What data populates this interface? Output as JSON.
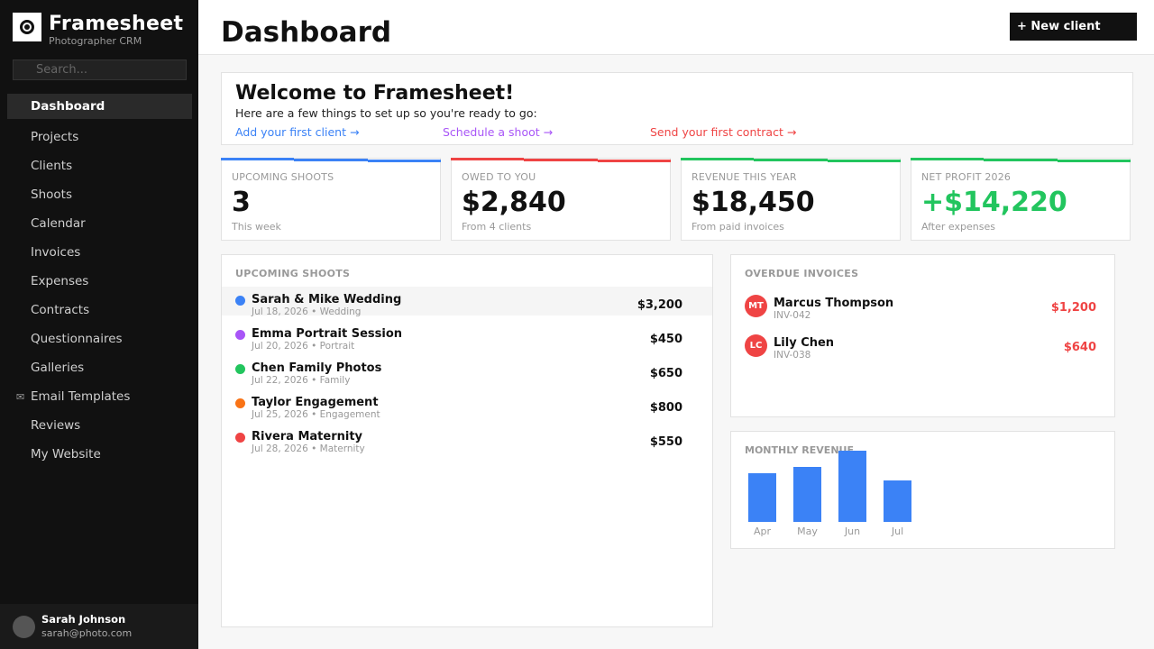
{
  "app": {
    "name": "Framesheet",
    "tagline": "Photographer CRM"
  },
  "search": {
    "placeholder": "Search..."
  },
  "nav": [
    {
      "icon": "dashboard-icon",
      "glyph": "",
      "label": "Dashboard",
      "active": true
    },
    {
      "icon": "projects-icon",
      "glyph": "",
      "label": "Projects"
    },
    {
      "icon": "clients-icon",
      "glyph": "",
      "label": "Clients"
    },
    {
      "icon": "shoots-icon",
      "glyph": "",
      "label": "Shoots"
    },
    {
      "icon": "calendar-icon",
      "glyph": "",
      "label": "Calendar"
    },
    {
      "icon": "invoices-icon",
      "glyph": "",
      "label": "Invoices"
    },
    {
      "icon": "expenses-icon",
      "glyph": "",
      "label": "Expenses"
    },
    {
      "icon": "contracts-icon",
      "glyph": "",
      "label": "Contracts"
    },
    {
      "icon": "questionnaires-icon",
      "glyph": "",
      "label": "Questionnaires"
    },
    {
      "icon": "galleries-icon",
      "glyph": "",
      "label": "Galleries"
    },
    {
      "icon": "email-icon",
      "glyph": "✉",
      "label": "Email Templates"
    },
    {
      "icon": "reviews-icon",
      "glyph": "",
      "label": "Reviews"
    },
    {
      "icon": "website-icon",
      "glyph": "",
      "label": "My Website"
    }
  ],
  "user": {
    "name": "Sarah Johnson",
    "email": "sarah@photo.com"
  },
  "header": {
    "title": "Dashboard",
    "new_client_label": "+ New client"
  },
  "welcome": {
    "title": "Welcome to Framesheet! ",
    "subtitle": "Here are a few things to set up so you're ready to go:",
    "links": [
      {
        "label": "Add your first client →",
        "color": "#3b82f6"
      },
      {
        "label": "Schedule a shoot →",
        "color": "#a855f7"
      },
      {
        "label": "Send your first contract →",
        "color": "#ef4444"
      }
    ]
  },
  "stats": [
    {
      "label": "UPCOMING SHOOTS",
      "value": "3",
      "note": "This week",
      "color": "#3b82f6",
      "value_color": "#111111"
    },
    {
      "label": "OWED TO YOU",
      "value": "$2,840",
      "note": "From 4 clients",
      "color": "#ef4444",
      "value_color": "#111111"
    },
    {
      "label": "REVENUE THIS YEAR",
      "value": "$18,450",
      "note": "From paid invoices",
      "color": "#22c55e",
      "value_color": "#111111"
    },
    {
      "label": "NET PROFIT 2026",
      "value": "+$14,220",
      "note": "After expenses",
      "color": "#22c55e",
      "value_color": "#22c55e"
    }
  ],
  "upcoming": {
    "title": "UPCOMING SHOOTS",
    "rows": [
      {
        "name": "Sarah & Mike Wedding",
        "date": "Jul 18, 2026",
        "type": "Wedding",
        "price": "$3,200",
        "color": "#3b82f6"
      },
      {
        "name": "Emma Portrait Session",
        "date": "Jul 20, 2026",
        "type": "Portrait",
        "price": "$450",
        "color": "#a855f7"
      },
      {
        "name": "Chen Family Photos",
        "date": "Jul 22, 2026",
        "type": "Family",
        "price": "$650",
        "color": "#22c55e"
      },
      {
        "name": "Taylor Engagement",
        "date": "Jul 25, 2026",
        "type": "Engagement",
        "price": "$800",
        "color": "#f97316"
      },
      {
        "name": "Rivera Maternity",
        "date": "Jul 28, 2026",
        "type": "Maternity",
        "price": "$550",
        "color": "#ef4444"
      }
    ]
  },
  "overdue": {
    "title": "OVERDUE INVOICES",
    "rows": [
      {
        "initials": "MT",
        "name": "Marcus Thompson",
        "invoice": "INV-042",
        "amount": "$1,200"
      },
      {
        "initials": "LC",
        "name": "Lily Chen",
        "invoice": "INV-038",
        "amount": "$640"
      }
    ]
  },
  "chart_data": {
    "type": "bar",
    "title": "MONTHLY REVENUE",
    "categories": [
      "Apr",
      "May",
      "Jun",
      "Jul"
    ],
    "values": [
      54,
      61,
      79,
      46
    ],
    "color": "#3b82f6"
  }
}
